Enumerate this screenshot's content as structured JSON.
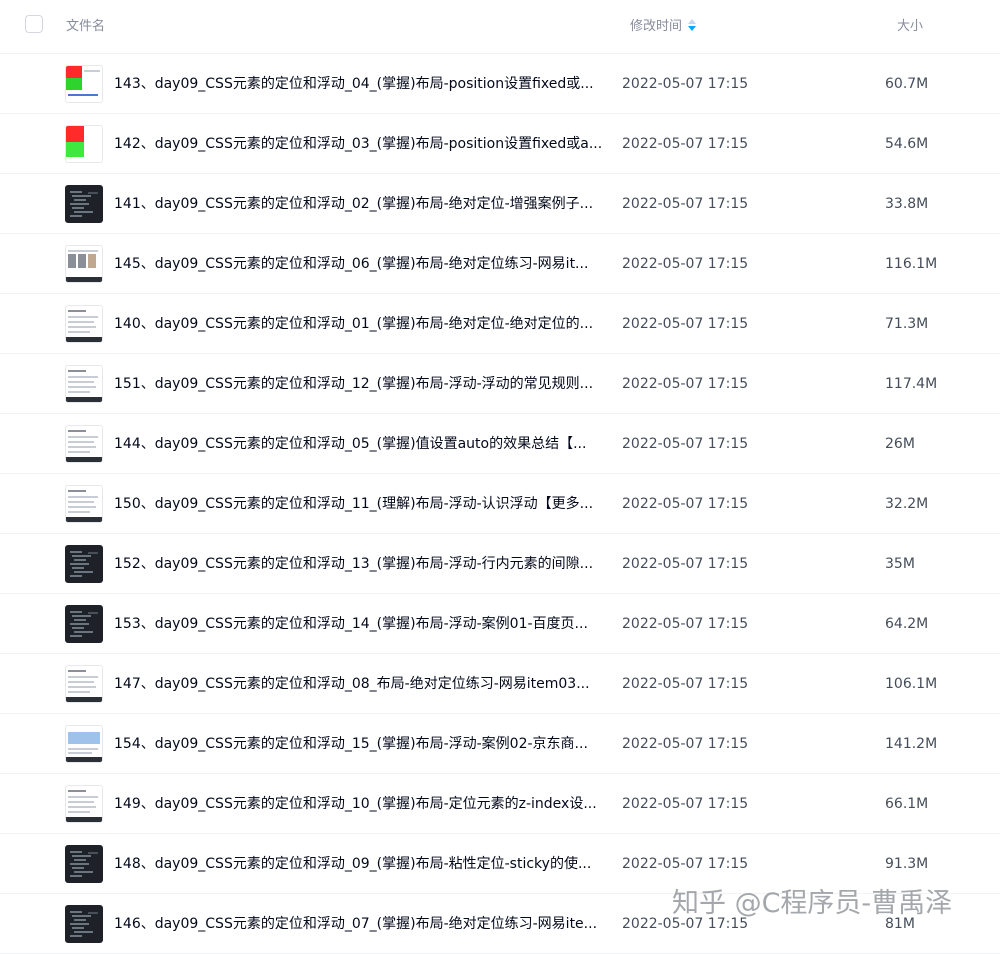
{
  "header": {
    "col_name": "文件名",
    "col_time": "修改时间",
    "col_size": "大小"
  },
  "files": [
    {
      "name": "143、day09_CSS元素的定位和浮动_04_(掌握)布局-position设置fixed或...",
      "time": "2022-05-07 17:15",
      "size": "60.7M",
      "thumb": "red"
    },
    {
      "name": "142、day09_CSS元素的定位和浮动_03_(掌握)布局-position设置fixed或a...",
      "time": "2022-05-07 17:15",
      "size": "54.6M",
      "thumb": "redgreen"
    },
    {
      "name": "141、day09_CSS元素的定位和浮动_02_(掌握)布局-绝对定位-增强案例子...",
      "time": "2022-05-07 17:15",
      "size": "33.8M",
      "thumb": "dark"
    },
    {
      "name": "145、day09_CSS元素的定位和浮动_06_(掌握)布局-绝对定位练习-网易it...",
      "time": "2022-05-07 17:15",
      "size": "116.1M",
      "thumb": "gallery"
    },
    {
      "name": "140、day09_CSS元素的定位和浮动_01_(掌握)布局-绝对定位-绝对定位的...",
      "time": "2022-05-07 17:15",
      "size": "71.3M",
      "thumb": "light"
    },
    {
      "name": "151、day09_CSS元素的定位和浮动_12_(掌握)布局-浮动-浮动的常见规则...",
      "time": "2022-05-07 17:15",
      "size": "117.4M",
      "thumb": "light"
    },
    {
      "name": "144、day09_CSS元素的定位和浮动_05_(掌握)值设置auto的效果总结【...",
      "time": "2022-05-07 17:15",
      "size": "26M",
      "thumb": "light"
    },
    {
      "name": "150、day09_CSS元素的定位和浮动_11_(理解)布局-浮动-认识浮动【更多...",
      "time": "2022-05-07 17:15",
      "size": "32.2M",
      "thumb": "light"
    },
    {
      "name": "152、day09_CSS元素的定位和浮动_13_(掌握)布局-浮动-行内元素的间隙...",
      "time": "2022-05-07 17:15",
      "size": "35M",
      "thumb": "dark"
    },
    {
      "name": "153、day09_CSS元素的定位和浮动_14_(掌握)布局-浮动-案例01-百度页...",
      "time": "2022-05-07 17:15",
      "size": "64.2M",
      "thumb": "dark"
    },
    {
      "name": "147、day09_CSS元素的定位和浮动_08_布局-绝对定位练习-网易item03...",
      "time": "2022-05-07 17:15",
      "size": "106.1M",
      "thumb": "light"
    },
    {
      "name": "154、day09_CSS元素的定位和浮动_15_(掌握)布局-浮动-案例02-京东商...",
      "time": "2022-05-07 17:15",
      "size": "141.2M",
      "thumb": "blue"
    },
    {
      "name": "149、day09_CSS元素的定位和浮动_10_(掌握)布局-定位元素的z-index设...",
      "time": "2022-05-07 17:15",
      "size": "66.1M",
      "thumb": "light"
    },
    {
      "name": "148、day09_CSS元素的定位和浮动_09_(掌握)布局-粘性定位-sticky的使...",
      "time": "2022-05-07 17:15",
      "size": "91.3M",
      "thumb": "dark"
    },
    {
      "name": "146、day09_CSS元素的定位和浮动_07_(掌握)布局-绝对定位练习-网易ite...",
      "time": "2022-05-07 17:15",
      "size": "81M",
      "thumb": "dark"
    }
  ],
  "watermark": "知乎 @C程序员-曹禹泽",
  "colors": {
    "accent": "#06a7ff",
    "divider": "#f1f2f4",
    "header_text": "#878c9c"
  }
}
